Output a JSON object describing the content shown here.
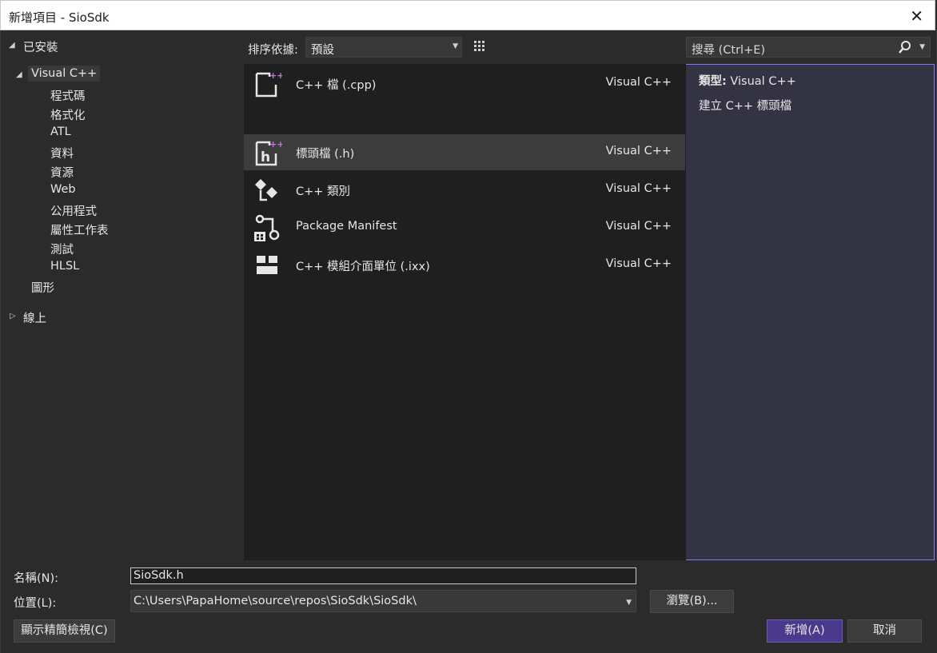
{
  "window": {
    "title": "新增項目 - SioSdk",
    "close_glyph": "✕"
  },
  "tree": {
    "installed": "已安裝",
    "visual_cpp": "Visual C++",
    "children": [
      "程式碼",
      "格式化",
      "ATL",
      "資料",
      "資源",
      "Web",
      "公用程式",
      "屬性工作表",
      "測試",
      "HLSL"
    ],
    "graphics": "圖形",
    "online": "線上"
  },
  "toolbar": {
    "sort_label": "排序依據:",
    "sort_value": "預設",
    "search_placeholder": "搜尋 (Ctrl+E)"
  },
  "templates": [
    {
      "name": "C++ 檔 (.cpp)",
      "lang": "Visual C++",
      "icon": "cpp-file-icon",
      "selected": false
    },
    {
      "name": "標頭檔 (.h)",
      "lang": "Visual C++",
      "icon": "header-file-icon",
      "selected": true
    },
    {
      "name": "C++ 類別",
      "lang": "Visual C++",
      "icon": "cpp-class-icon",
      "selected": false
    },
    {
      "name": "Package Manifest",
      "lang": "Visual C++",
      "icon": "package-manifest-icon",
      "selected": false
    },
    {
      "name": "C++ 模組介面單位 (.ixx)",
      "lang": "Visual C++",
      "icon": "module-interface-icon",
      "selected": false
    }
  ],
  "description": {
    "type_label": "類型:",
    "type_value": "Visual C++",
    "text": "建立 C++ 標頭檔"
  },
  "form": {
    "name_label": "名稱(N):",
    "name_value": "SioSdk.h",
    "location_label": "位置(L):",
    "location_value": "C:\\Users\\PapaHome\\source\\repos\\SioSdk\\SioSdk\\",
    "browse_button": "瀏覽(B)...",
    "compact_view_button": "顯示精簡檢視(C)",
    "add_button": "新增(A)",
    "cancel_button": "取消"
  },
  "colors": {
    "accent": "#4b3a8c",
    "sparkle": "#c678dd"
  }
}
